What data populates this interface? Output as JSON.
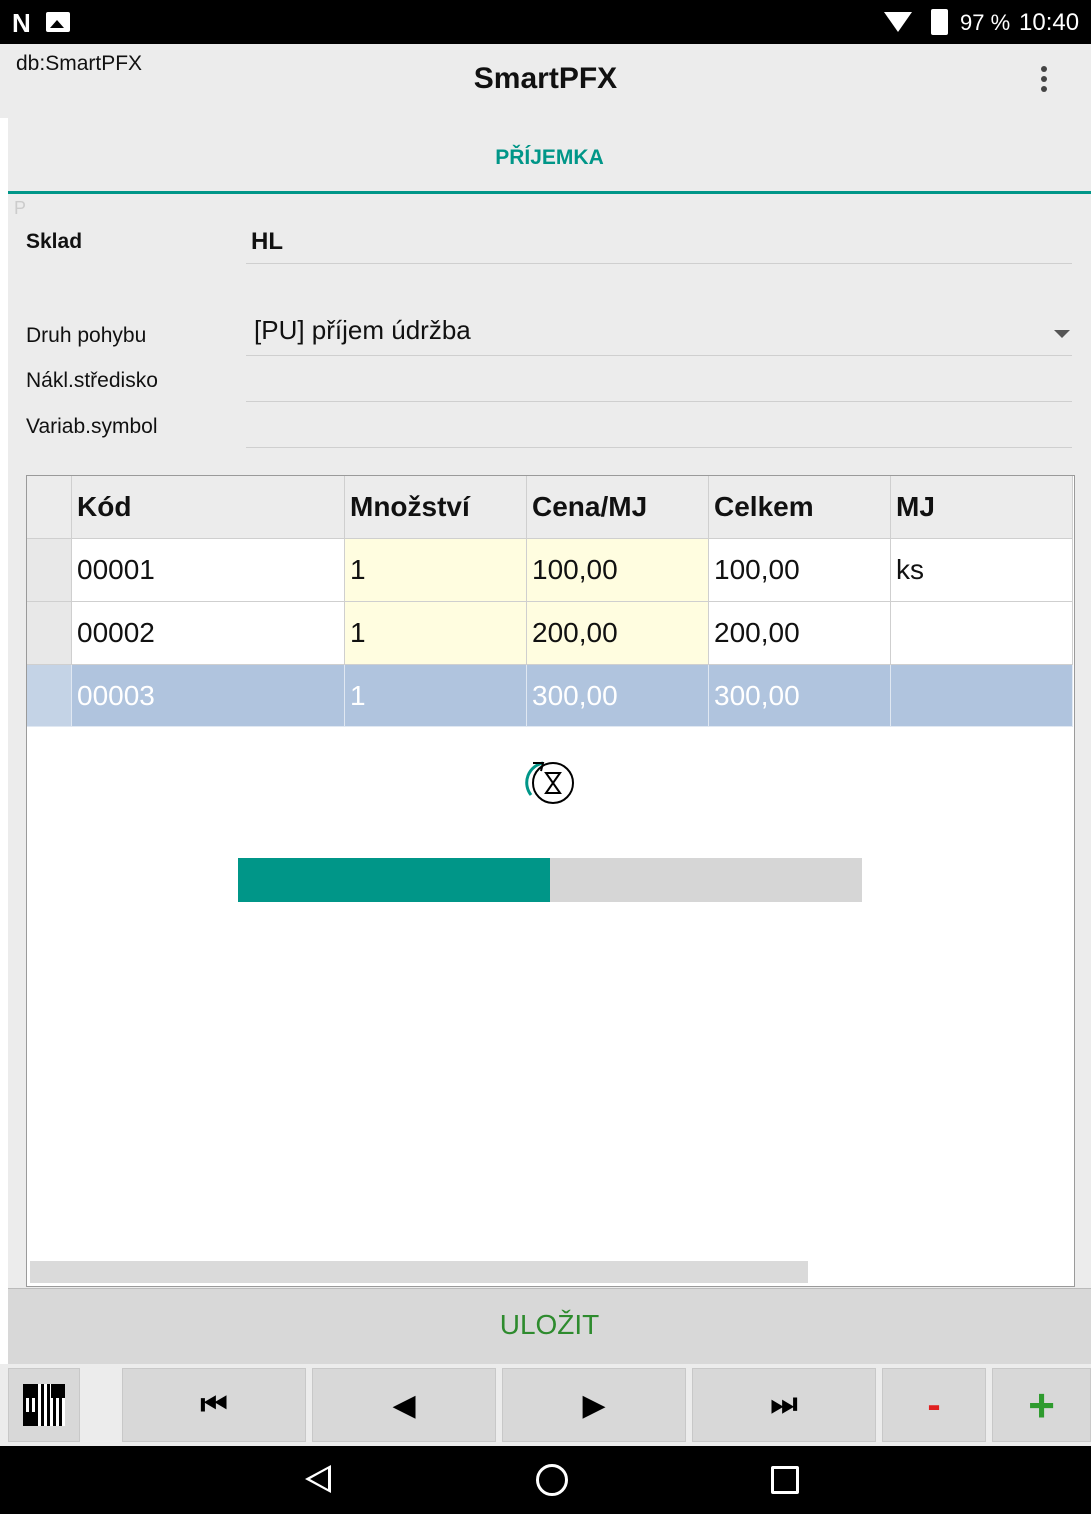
{
  "status_bar": {
    "battery_percent": "97 %",
    "time": "10:40",
    "icons": [
      "n-icon",
      "image-icon",
      "wifi-icon",
      "battery-icon"
    ]
  },
  "app_bar": {
    "db_label": "db:SmartPFX",
    "title": "SmartPFX",
    "menu_icon": "more-vert-icon"
  },
  "tab": {
    "label": "PŘÍJEMKA"
  },
  "form": {
    "p_marker": "P",
    "sklad": {
      "label": "Sklad",
      "value": "HL"
    },
    "druh_pohybu": {
      "label": "Druh pohybu",
      "value": "[PU] příjem údržba"
    },
    "nakl_stredisko": {
      "label": "Nákl.středisko",
      "value": ""
    },
    "variab_symbol": {
      "label": "Variab.symbol",
      "value": ""
    }
  },
  "grid": {
    "columns": [
      "Kód",
      "Množství",
      "Cena/MJ",
      "Celkem",
      "MJ"
    ],
    "rows": [
      [
        "00001",
        "1",
        "100,00",
        "100,00",
        "ks"
      ],
      [
        "00002",
        "1",
        "200,00",
        "200,00",
        ""
      ],
      [
        "00003",
        "1",
        "300,00",
        "300,00",
        ""
      ]
    ],
    "selected_row": 2,
    "progress": 0.5
  },
  "save_button": {
    "label": "ULOŽIT"
  },
  "nav_buttons": {
    "first": "⏮",
    "prev": "◀",
    "next": "▶",
    "last": "⏭",
    "minus": "-",
    "plus": "+"
  },
  "colors": {
    "accent": "#009688",
    "save_text": "#2e8b2e",
    "editable_cell": "#fffde0",
    "selected_row": "#b0c4de",
    "minus": "#e02020",
    "plus": "#2e9b2e"
  }
}
